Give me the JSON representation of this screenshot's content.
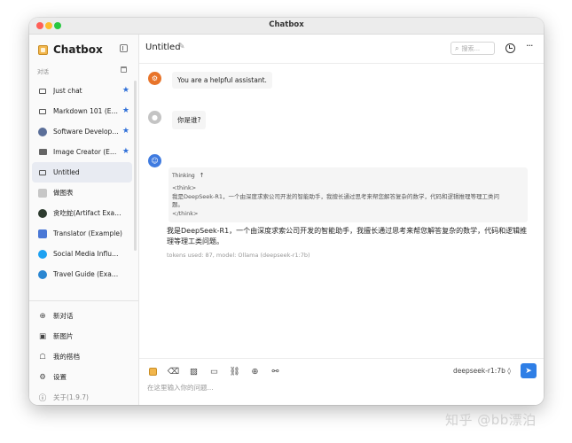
{
  "window": {
    "title": "Chatbox"
  },
  "sidebar": {
    "brand": "Chatbox",
    "section_label": "对话",
    "conversations": [
      {
        "label": "Just chat",
        "starred": true,
        "icon": "chat-bubble-icon"
      },
      {
        "label": "Markdown 101 (E…",
        "starred": true,
        "icon": "chat-bubble-icon"
      },
      {
        "label": "Software Develop…",
        "starred": true,
        "icon": "developer-avatar"
      },
      {
        "label": "Image Creator (E…",
        "starred": true,
        "icon": "image-icon"
      },
      {
        "label": "Untitled",
        "starred": false,
        "active": true,
        "icon": "chat-bubble-icon"
      },
      {
        "label": "做图表",
        "starred": false,
        "icon": "chart-avatar"
      },
      {
        "label": "贪吃蛇(Artifact Example)",
        "starred": false,
        "icon": "snake-avatar"
      },
      {
        "label": "Translator (Example)",
        "starred": false,
        "icon": "translator-avatar"
      },
      {
        "label": "Social Media Influence…",
        "starred": false,
        "icon": "twitter-avatar"
      },
      {
        "label": "Travel Guide (Example)",
        "starred": false,
        "icon": "travel-avatar"
      }
    ],
    "actions": [
      {
        "label": "新对话",
        "icon": "plus-circle-icon",
        "glyph": "⊕"
      },
      {
        "label": "新图片",
        "icon": "image-plus-icon",
        "glyph": "▣"
      },
      {
        "label": "我的搭档",
        "icon": "robot-icon",
        "glyph": "☖"
      },
      {
        "label": "设置",
        "icon": "gear-icon",
        "glyph": "⚙"
      },
      {
        "label": "关于(1.9.7)",
        "icon": "info-icon",
        "glyph": "ⓘ"
      }
    ],
    "star_glyph": "★"
  },
  "header": {
    "title": "Untitled",
    "search_placeholder": "搜索...",
    "more_glyph": "···"
  },
  "messages": {
    "system": "You are a helpful assistant.",
    "user": "你是谁?",
    "thinking_label": "Thinking",
    "thinking_arrow": "↑",
    "thinking_lines": [
      "<think>",
      "我是DeepSeek-R1，一个由深度求索公司开发的智能助手，我擅长通过思考来帮您解答复杂的数学，代码和逻辑推理等理工类问",
      "题。",
      "</think>"
    ],
    "answer": "我是DeepSeek-R1，一个由深度求索公司开发的智能助手，我擅长通过思考来帮您解答复杂的数学，代码和逻辑推理等理工类问题。",
    "tokens": "tokens used: 87, model: Ollama (deepseek-r1:7b)"
  },
  "composer": {
    "model": "deepseek-r1:7b ◊",
    "placeholder": "在这里输入你的问题...",
    "tool_glyphs": [
      "⌫",
      "▨",
      "▭",
      "⛓",
      "⊕",
      "⚯"
    ]
  },
  "watermark": "知乎 @bb漂泊",
  "colors": {
    "accent": "#2f7fe6",
    "system_avatar": "#e8742a",
    "star": "#2f6fd8"
  }
}
